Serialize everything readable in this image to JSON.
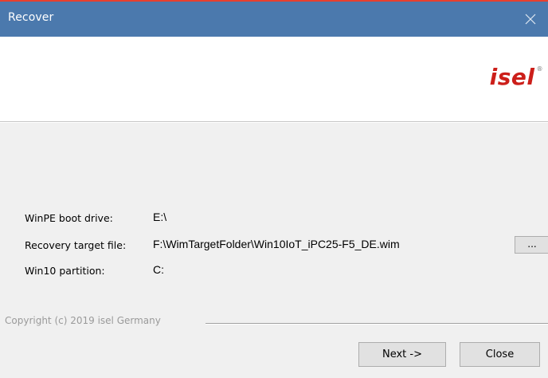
{
  "window": {
    "title": "Recover",
    "accent_color": "#4b79ad",
    "title_text_color": "#ffffff"
  },
  "banner": {
    "logo_text": "isel",
    "logo_mark": "®",
    "logo_color": "#cc1f1a"
  },
  "fields": {
    "boot_drive": {
      "label": "WinPE boot drive:",
      "value": "E:\\"
    },
    "target_file": {
      "label": "Recovery target file:",
      "value": "F:\\WimTargetFolder\\Win10IoT_iPC25-F5_DE.wim",
      "browse_label": "..."
    },
    "partition": {
      "label": "Win10 partition:",
      "value": "C:"
    }
  },
  "footer": {
    "copyright": "Copyright (c) 2019 isel Germany",
    "next_label": "Next ->",
    "close_label": "Close"
  },
  "icons": {
    "window_close": "close-icon"
  }
}
